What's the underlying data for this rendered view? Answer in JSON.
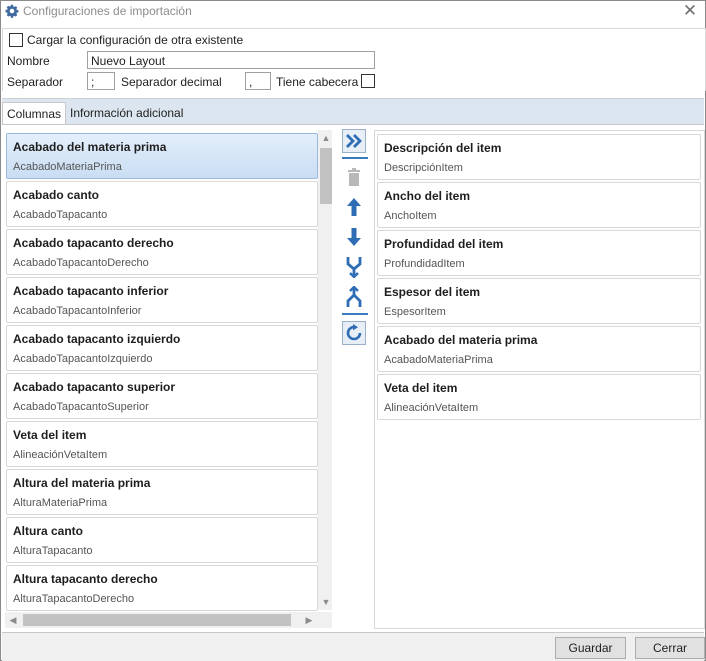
{
  "window": {
    "title": "Configuraciones de importación",
    "title_icon": "gear-icon",
    "close_icon": "close-icon"
  },
  "config": {
    "load_existing_label": "Cargar la configuración de otra existente",
    "load_existing_checked": false,
    "name_label": "Nombre",
    "name_value": "Nuevo Layout",
    "separator_label": "Separador",
    "separator_value": ";",
    "decimal_separator_label": "Separador decimal",
    "decimal_separator_value": ",",
    "has_header_label": "Tiene cabecera",
    "has_header_checked": false
  },
  "tabs": [
    {
      "label": "Columnas",
      "active": true
    },
    {
      "label": "Información adicional",
      "active": false
    }
  ],
  "available_columns": [
    {
      "title": "Acabado del materia prima",
      "field": "AcabadoMateriaPrima",
      "selected": true
    },
    {
      "title": "Acabado canto",
      "field": "AcabadoTapacanto"
    },
    {
      "title": "Acabado tapacanto derecho",
      "field": "AcabadoTapacantoDerecho"
    },
    {
      "title": "Acabado tapacanto inferior",
      "field": "AcabadoTapacantoInferior"
    },
    {
      "title": "Acabado tapacanto izquierdo",
      "field": "AcabadoTapacantoIzquierdo"
    },
    {
      "title": "Acabado tapacanto superior",
      "field": "AcabadoTapacantoSuperior"
    },
    {
      "title": "Veta del item",
      "field": "AlineaciónVetaItem"
    },
    {
      "title": "Altura del materia prima",
      "field": "AlturaMateriaPrima"
    },
    {
      "title": "Altura canto",
      "field": "AlturaTapacanto"
    },
    {
      "title": "Altura tapacanto derecho",
      "field": "AlturaTapacantoDerecho"
    }
  ],
  "selected_columns": [
    {
      "title": "Descripción del item",
      "field": "DescripciónItem"
    },
    {
      "title": "Ancho del item",
      "field": "AnchoItem"
    },
    {
      "title": "Profundidad del item",
      "field": "ProfundidadItem"
    },
    {
      "title": "Espesor del item",
      "field": "EspesorItem"
    },
    {
      "title": "Acabado del materia prima",
      "field": "AcabadoMateriaPrima"
    },
    {
      "title": "Veta del item",
      "field": "AlineaciónVetaItem"
    }
  ],
  "toolbar": {
    "add_icon": "double-chevron-right-icon",
    "delete_icon": "trash-icon",
    "up_icon": "arrow-up-icon",
    "down_icon": "arrow-down-icon",
    "merge_icon": "merge-icon",
    "split_icon": "split-icon",
    "refresh_icon": "refresh-icon"
  },
  "footer": {
    "save_label": "Guardar",
    "close_label": "Cerrar"
  },
  "colors": {
    "accent": "#3a7bbf",
    "tab_strip": "#dbe6f0",
    "icon_blue": "#2e6db4",
    "icon_gray": "#b8b8b8"
  }
}
